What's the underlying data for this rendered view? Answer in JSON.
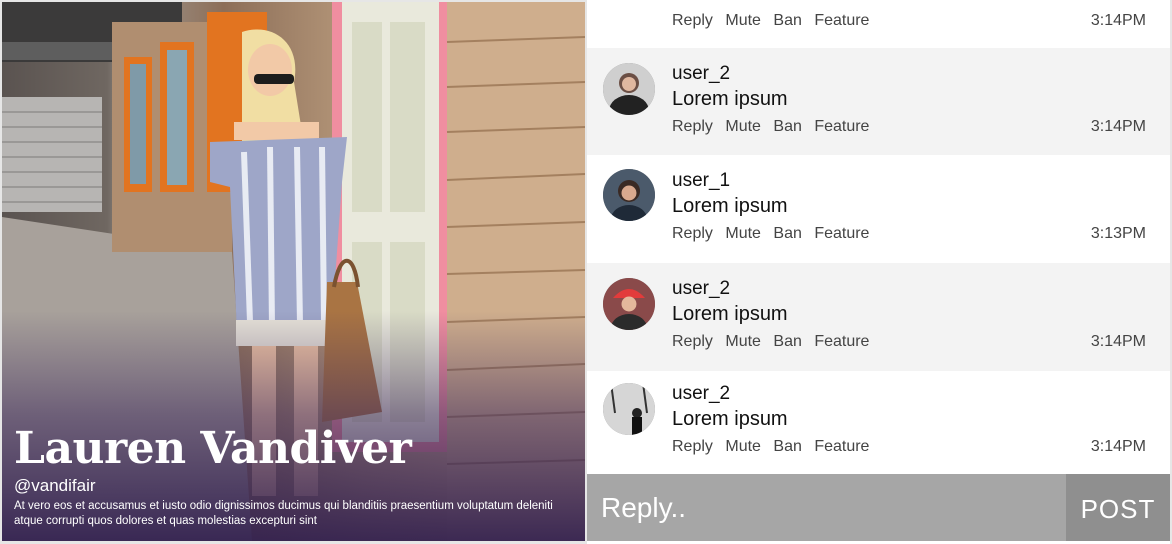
{
  "profile": {
    "name": "Lauren Vandiver",
    "handle": "@vandifair",
    "bio": "At vero eos et accusamus et iusto odio dignissimos ducimus qui blanditiis praesentium voluptatum deleniti atque corrupti quos dolores et quas molestias excepturi sint"
  },
  "actions": {
    "reply": "Reply",
    "mute": "Mute",
    "ban": "Ban",
    "feature": "Feature"
  },
  "top_partial_message": {
    "time": "3:14PM"
  },
  "messages": [
    {
      "user": "user_2",
      "text": "Lorem ipsum",
      "time": "3:14PM"
    },
    {
      "user": "user_1",
      "text": "Lorem ipsum",
      "time": "3:13PM"
    },
    {
      "user": "user_2",
      "text": "Lorem ipsum",
      "time": "3:14PM"
    },
    {
      "user": "user_2",
      "text": "Lorem ipsum",
      "time": "3:14PM"
    }
  ],
  "composer": {
    "placeholder": "Reply..",
    "post_label": "POST"
  }
}
